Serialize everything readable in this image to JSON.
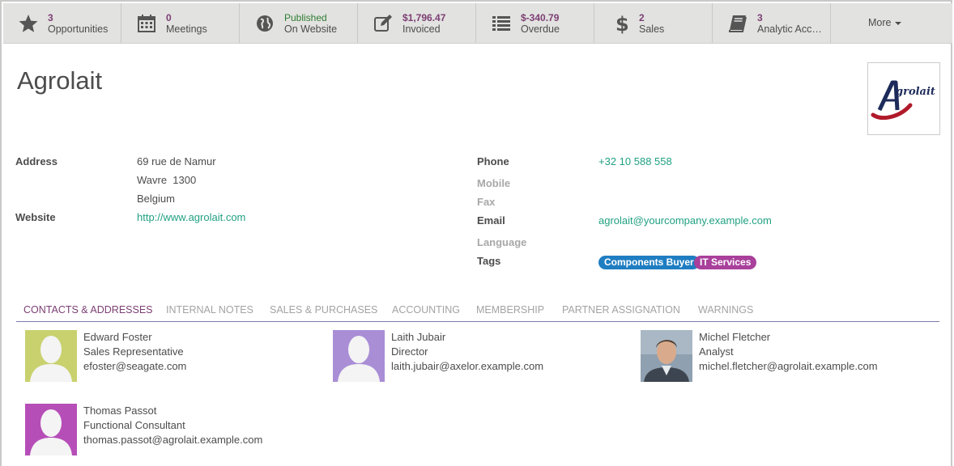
{
  "stat_buttons": [
    {
      "value": "3",
      "label": "Opportunities",
      "icon": "star-icon"
    },
    {
      "value": "0",
      "label": "Meetings",
      "icon": "calendar-icon"
    },
    {
      "value": "Published",
      "label": "On Website",
      "icon": "globe-icon"
    },
    {
      "value": "$1,796.47",
      "label": "Invoiced",
      "icon": "pencil-square-icon"
    },
    {
      "value": "$-340.79",
      "label": "Overdue",
      "icon": "list-icon"
    },
    {
      "value": "2",
      "label": "Sales",
      "icon": "dollar-icon"
    },
    {
      "value": "3",
      "label": "Analytic Acc…",
      "icon": "book-icon"
    }
  ],
  "more_label": "More",
  "partner": {
    "name": "Agrolait",
    "logo_text": "grolait"
  },
  "address": {
    "label": "Address",
    "line1": "69 rue de Namur",
    "line2": "Wavre  1300",
    "line3": "Belgium"
  },
  "website": {
    "label": "Website",
    "value": "http://www.agrolait.com"
  },
  "phone": {
    "label": "Phone",
    "value": "+32 10 588 558"
  },
  "mobile": {
    "label": "Mobile",
    "value": ""
  },
  "fax": {
    "label": "Fax",
    "value": ""
  },
  "email": {
    "label": "Email",
    "value": "agrolait@yourcompany.example.com"
  },
  "language": {
    "label": "Language",
    "value": ""
  },
  "tags": {
    "label": "Tags",
    "items": [
      {
        "name": "Components Buyer",
        "color": "#1f7ec2"
      },
      {
        "name": "IT Services",
        "color": "#a9409b"
      }
    ]
  },
  "tabs": [
    "CONTACTS & ADDRESSES",
    "INTERNAL NOTES",
    "SALES & PURCHASES",
    "ACCOUNTING",
    "MEMBERSHIP",
    "PARTNER ASSIGNATION",
    "WARNINGS"
  ],
  "contacts": [
    {
      "name": "Edward Foster",
      "title": "Sales Representative",
      "email": "efoster@seagate.com",
      "avatar_color": "#c8d16e"
    },
    {
      "name": "Laith Jubair",
      "title": "Director",
      "email": "laith.jubair@axelor.example.com",
      "avatar_color": "#a98ed6"
    },
    {
      "name": "Michel Fletcher",
      "title": "Analyst",
      "email": "michel.fletcher@agrolait.example.com",
      "avatar_color": "photo"
    },
    {
      "name": "Thomas Passot",
      "title": "Functional Consultant",
      "email": "thomas.passot@agrolait.example.com",
      "avatar_color": "#b64eb8"
    }
  ],
  "colors": {
    "accent": "#7c3e73",
    "link": "#21a183",
    "published": "#2e7d32"
  }
}
